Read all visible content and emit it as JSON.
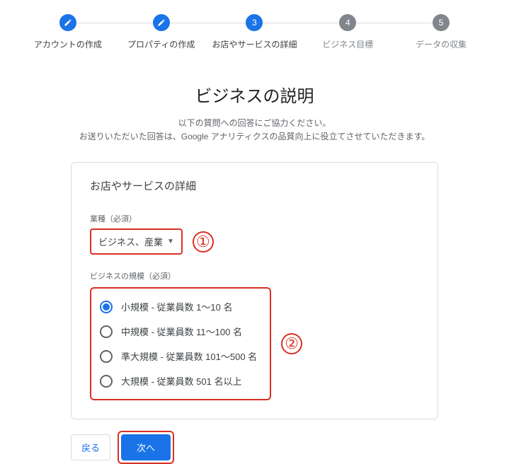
{
  "stepper": {
    "steps": [
      {
        "label": "アカウントの作成",
        "state": "done"
      },
      {
        "label": "プロパティの作成",
        "state": "done"
      },
      {
        "label": "お店やサービスの詳細",
        "state": "active",
        "number": "3"
      },
      {
        "label": "ビジネス目標",
        "state": "pending",
        "number": "4"
      },
      {
        "label": "データの収集",
        "state": "pending",
        "number": "5"
      }
    ]
  },
  "heading": {
    "title": "ビジネスの説明",
    "sub1": "以下の質問への回答にご協力ください。",
    "sub2": "お送りいただいた回答は、Google アナリティクスの品質向上に役立てさせていただきます。"
  },
  "card": {
    "title": "お店やサービスの詳細"
  },
  "industry": {
    "label": "業種（必須）",
    "value": "ビジネス、産業"
  },
  "size": {
    "label": "ビジネスの規模（必須）",
    "options": [
      "小規模 - 従業員数 1～10 名",
      "中規模 - 従業員数 11～100 名",
      "準大規模 - 従業員数 101～500 名",
      "大規模 - 従業員数 501 名以上"
    ],
    "selected_index": 0
  },
  "annotations": {
    "one": "①",
    "two": "②"
  },
  "buttons": {
    "back": "戻る",
    "next": "次へ"
  }
}
